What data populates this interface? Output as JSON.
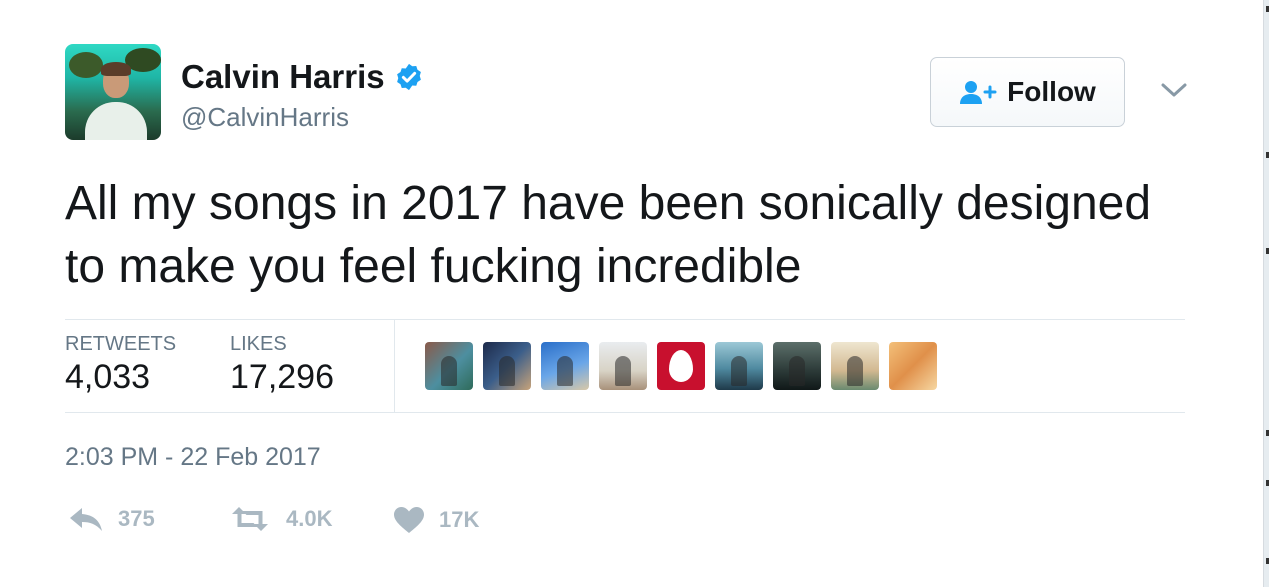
{
  "user": {
    "name": "Calvin Harris",
    "handle": "@CalvinHarris",
    "verified": true
  },
  "follow_button": {
    "label": "Follow",
    "icon": "add-user-icon"
  },
  "tweet": {
    "text": "All my songs in 2017 have been sonically designed to make you feel fucking incredible",
    "timestamp": "2:03 PM - 22 Feb 2017"
  },
  "stats": {
    "retweets_label": "RETWEETS",
    "retweets_value": "4,033",
    "likes_label": "LIKES",
    "likes_value": "17,296"
  },
  "actions": {
    "reply_count": "375",
    "retweet_count": "4.0K",
    "like_count": "17K"
  },
  "colors": {
    "text": "#14171a",
    "secondary": "#657786",
    "verified_blue": "#1da1f2",
    "action_gray": "#aab8c2",
    "divider": "#e1e8ed"
  }
}
